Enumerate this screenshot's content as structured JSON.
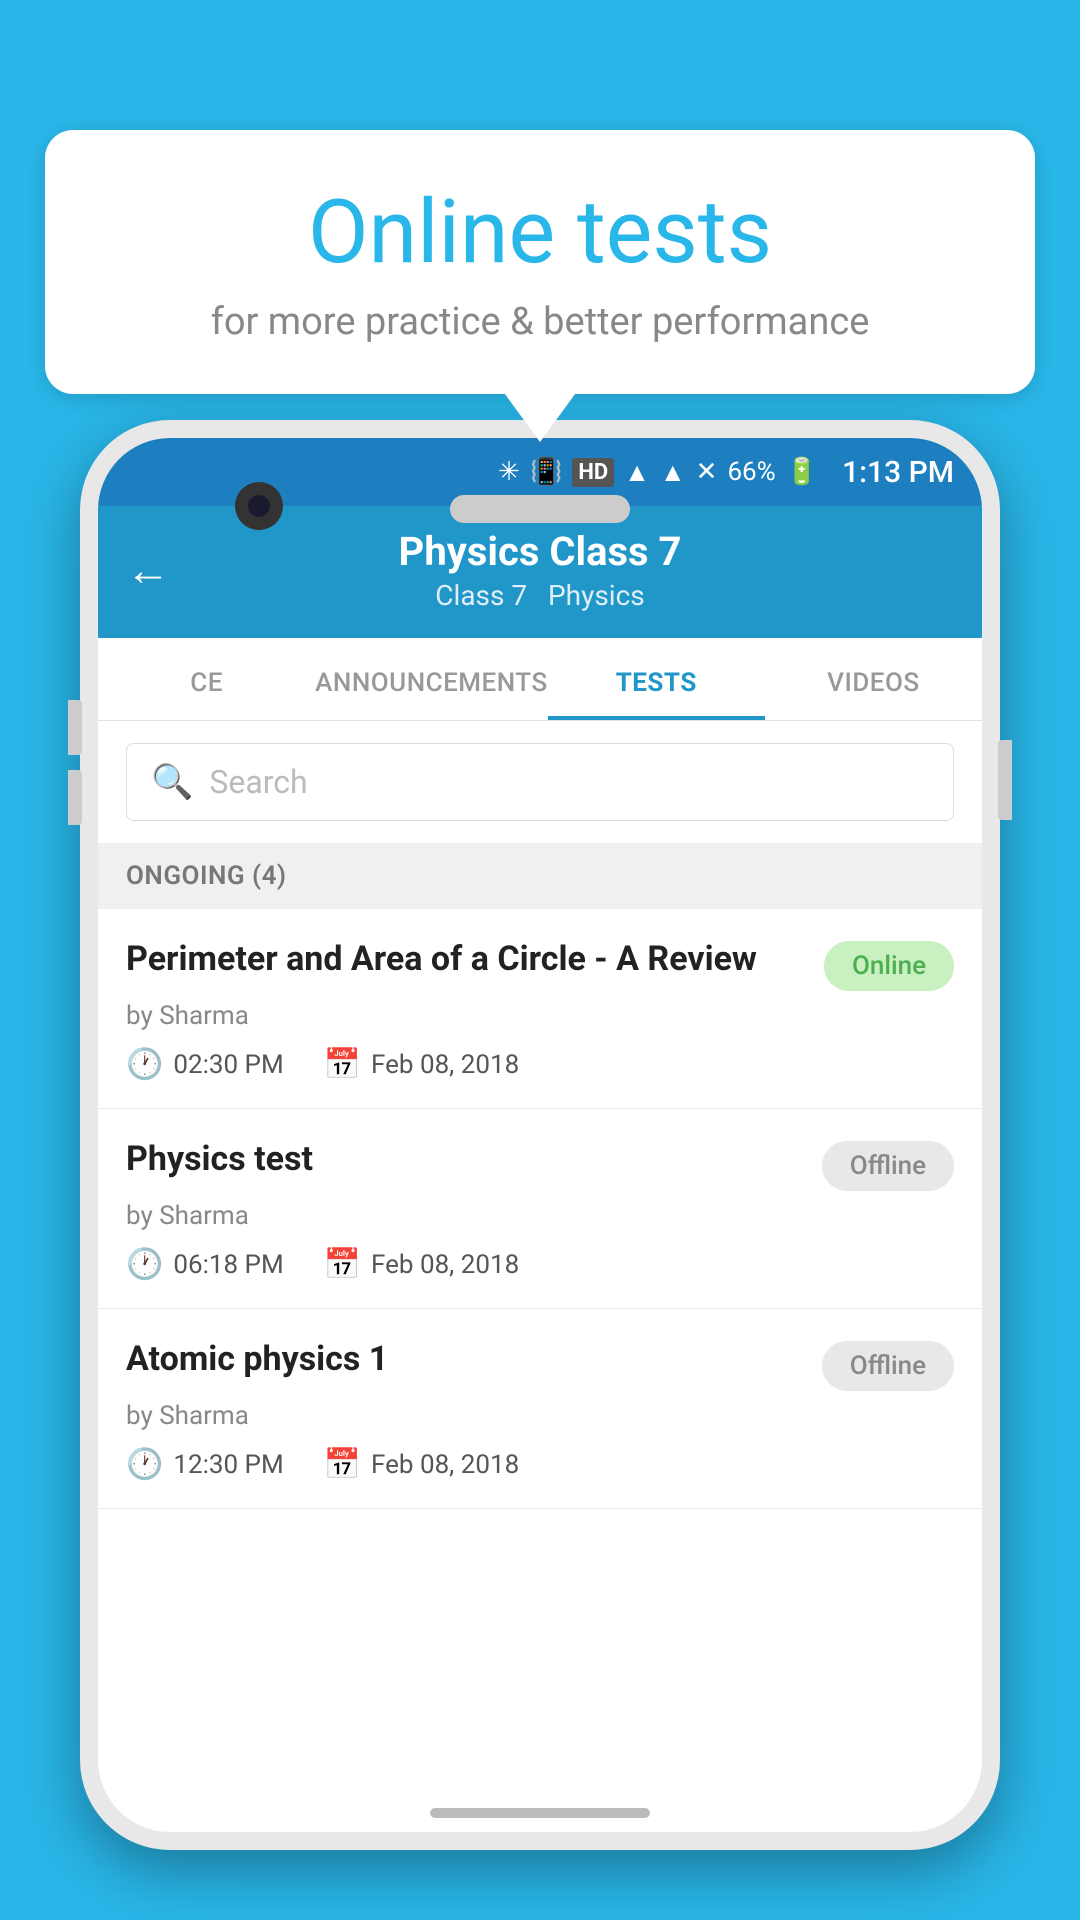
{
  "background_color": "#29b6e8",
  "bubble": {
    "title": "Online tests",
    "subtitle": "for more practice & better performance"
  },
  "status_bar": {
    "icons_text": "❄ 📳 HD ▲ ✕ 66%",
    "battery_text": "66%",
    "time": "1:13 PM"
  },
  "header": {
    "back_label": "←",
    "title": "Physics Class 7",
    "subtitle_class": "Class 7",
    "subtitle_subject": "Physics"
  },
  "tabs": [
    {
      "label": "CE",
      "active": false
    },
    {
      "label": "ANNOUNCEMENTS",
      "active": false
    },
    {
      "label": "TESTS",
      "active": true
    },
    {
      "label": "VIDEOS",
      "active": false
    }
  ],
  "search": {
    "placeholder": "Search"
  },
  "section": {
    "label": "ONGOING (4)"
  },
  "tests": [
    {
      "title": "Perimeter and Area of a Circle - A Review",
      "status": "Online",
      "status_type": "online",
      "author": "by Sharma",
      "time": "02:30 PM",
      "date": "Feb 08, 2018"
    },
    {
      "title": "Physics test",
      "status": "Offline",
      "status_type": "offline",
      "author": "by Sharma",
      "time": "06:18 PM",
      "date": "Feb 08, 2018"
    },
    {
      "title": "Atomic physics 1",
      "status": "Offline",
      "status_type": "offline",
      "author": "by Sharma",
      "time": "12:30 PM",
      "date": "Feb 08, 2018"
    }
  ]
}
